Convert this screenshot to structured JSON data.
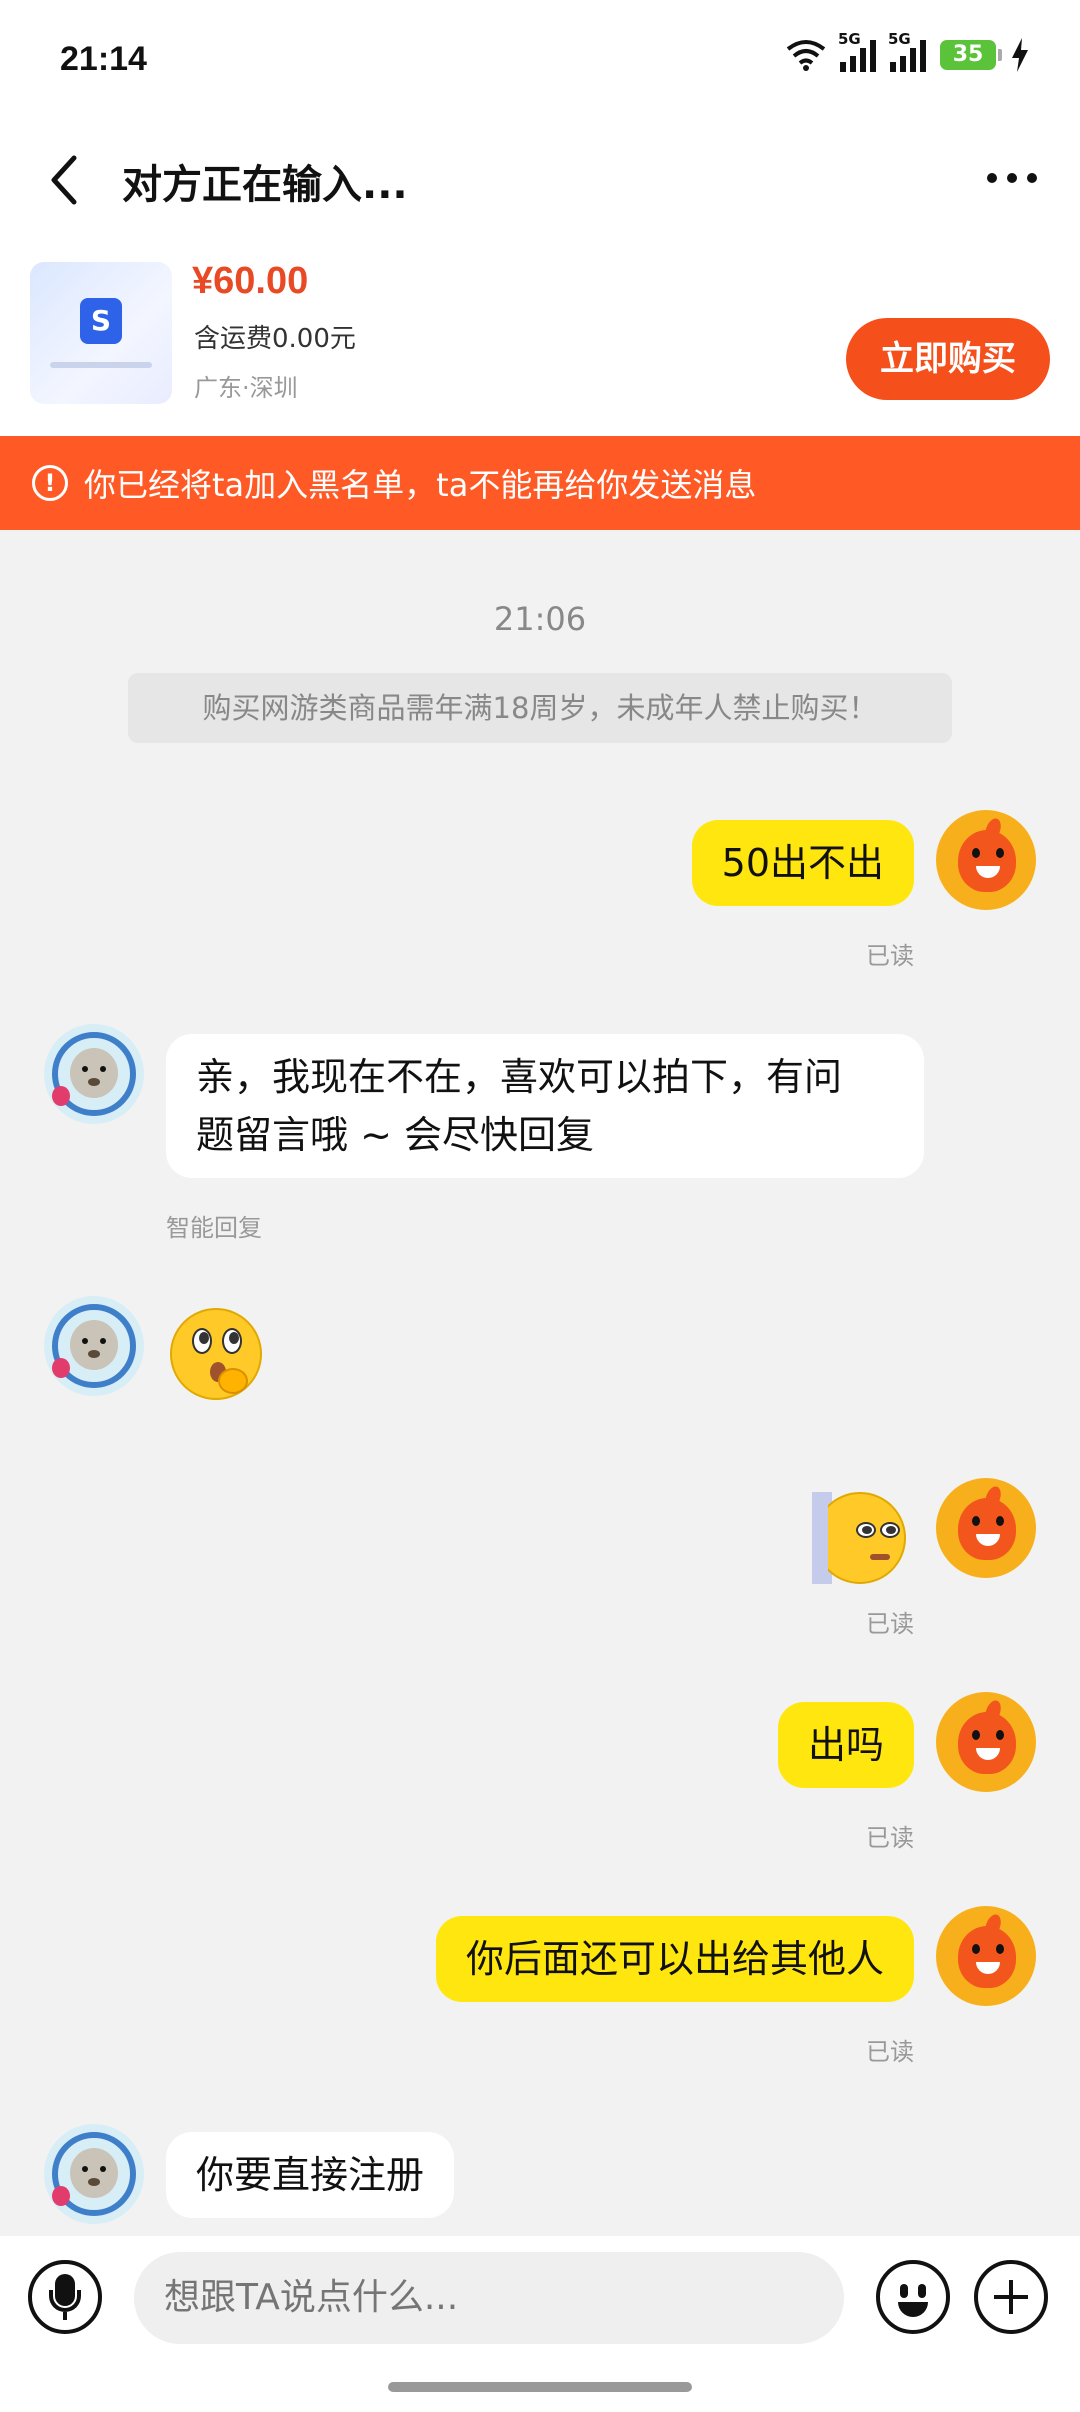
{
  "status_bar": {
    "time": "21:14",
    "network_1": "5G",
    "network_2": "5G",
    "battery": "35"
  },
  "header": {
    "title": "对方正在输入..."
  },
  "product": {
    "price": "¥60.00",
    "shipping": "含运费0.00元",
    "location": "广东·深圳",
    "buy_label": "立即购买",
    "thumb_mark": "S"
  },
  "warning": {
    "icon": "!",
    "text": "你已经将ta加入黑名单，ta不能再给你发送消息"
  },
  "chat": {
    "timestamp": "21:06",
    "notice": "购买网游类商品需年满18周岁，未成年人禁止购买！",
    "messages": [
      {
        "from": "me",
        "text": "50出不出",
        "status": "已读"
      },
      {
        "from": "them",
        "text_line1": "亲，我现在不在，喜欢可以拍下，有问",
        "text_line2": "题留言哦 ~ 会尽快回复",
        "tag": "智能回复"
      },
      {
        "from": "them",
        "sticker": "thinking-face-emoji"
      },
      {
        "from": "me",
        "sticker": "peeking-face-emoji",
        "status": "已读"
      },
      {
        "from": "me",
        "text": "出吗",
        "status": "已读"
      },
      {
        "from": "me",
        "text": "你后面还可以出给其他人",
        "status": "已读"
      },
      {
        "from": "them",
        "text": "你要直接注册"
      }
    ]
  },
  "input_bar": {
    "placeholder": "想跟TA说点什么..."
  },
  "colors": {
    "accent": "#ff5a26",
    "price": "#e84a25",
    "my_bubble": "#ffe60f"
  }
}
